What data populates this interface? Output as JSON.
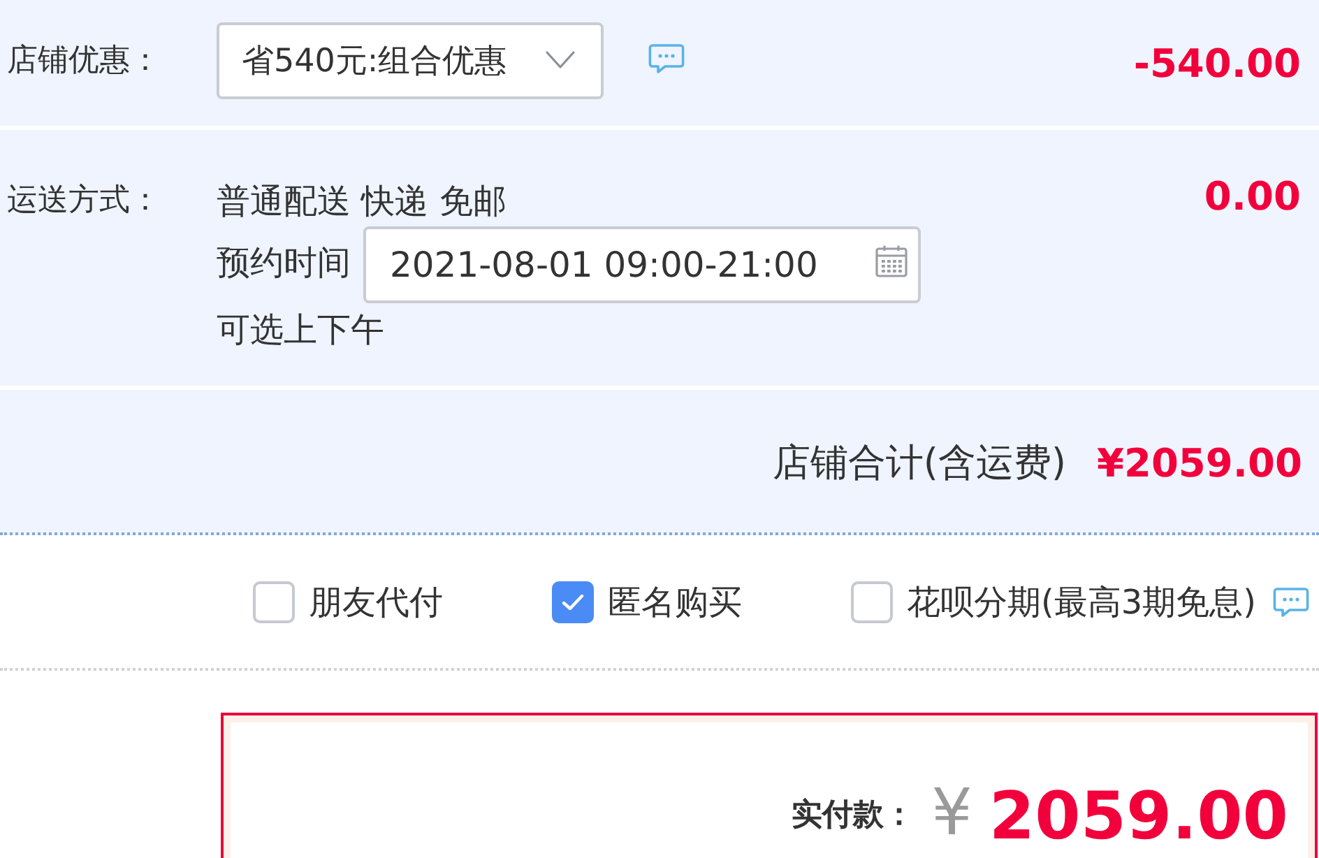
{
  "store_discount": {
    "label": "店铺优惠：",
    "dropdown": {
      "value": "省540元:组合优惠"
    },
    "amount": "-540.00"
  },
  "shipping": {
    "label": "运送方式：",
    "method": "普通配送 快递 免邮",
    "amount": "0.00",
    "appointment": {
      "label": "预约时间",
      "value": "2021-08-01 09:00-21:00"
    },
    "note": "可选上下午"
  },
  "store_total": {
    "label": "店铺合计(含运费)",
    "amount": "¥2059.00"
  },
  "options": [
    {
      "label": "朋友代付",
      "checked": false,
      "info_icon": false
    },
    {
      "label": "匿名购买",
      "checked": true,
      "info_icon": false
    },
    {
      "label": "花呗分期(最高3期免息)",
      "checked": false,
      "info_icon": true
    }
  ],
  "payment": {
    "label": "实付款：",
    "currency": "¥",
    "amount": "2059.00"
  }
}
